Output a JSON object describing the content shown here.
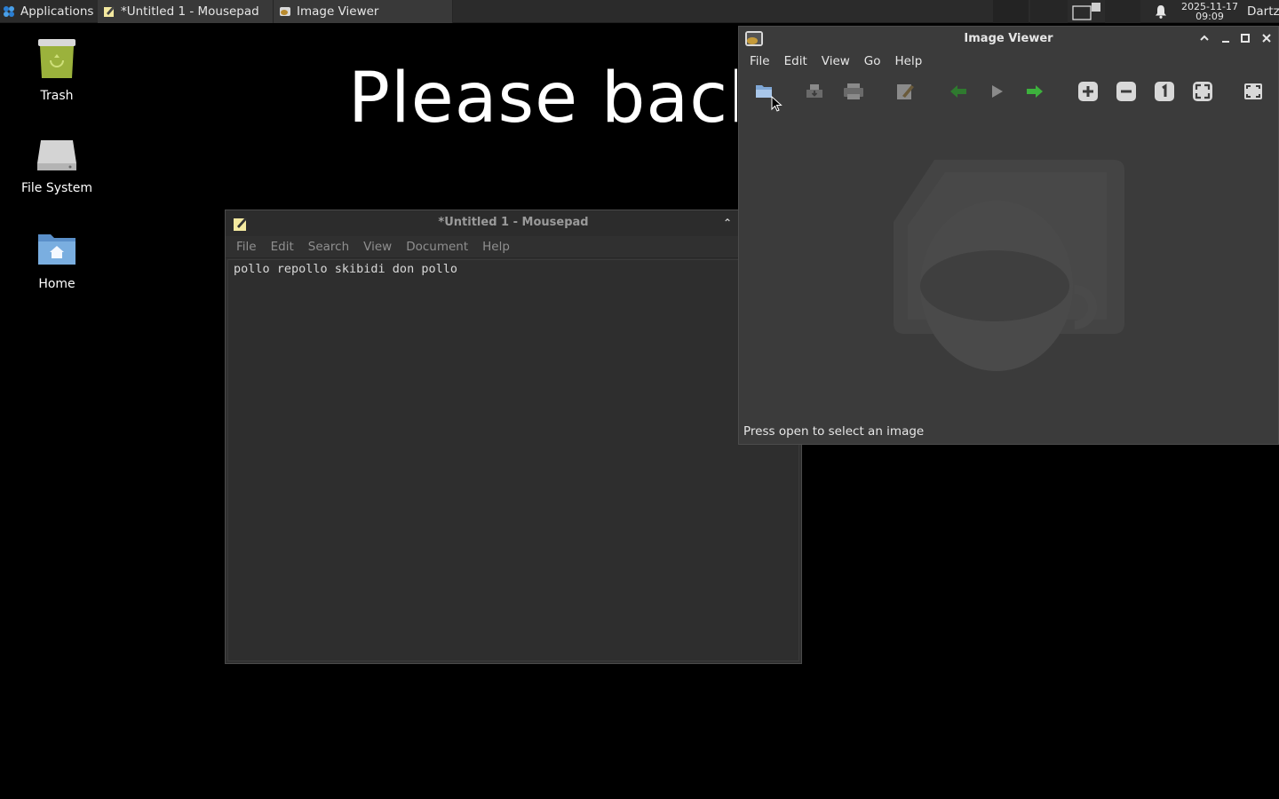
{
  "taskbar": {
    "applications_label": "Applications",
    "tasks": [
      {
        "label": "*Untitled 1 - Mousepad",
        "icon": "mousepad-icon"
      },
      {
        "label": "Image Viewer",
        "icon": "image-viewer-icon"
      }
    ],
    "clock_date": "2025-11-17",
    "clock_time": "09:09",
    "user": "Dartz"
  },
  "desktop": {
    "icons": [
      {
        "label": "Trash",
        "icon": "trash-icon"
      },
      {
        "label": "File System",
        "icon": "drive-icon"
      },
      {
        "label": "Home",
        "icon": "home-folder-icon"
      }
    ],
    "wallpaper_text": "Please back I"
  },
  "mousepad": {
    "title": "*Untitled 1 - Mousepad",
    "menu": [
      "File",
      "Edit",
      "Search",
      "View",
      "Document",
      "Help"
    ],
    "content": "pollo repollo skibidi don pollo"
  },
  "image_viewer": {
    "title": "Image Viewer",
    "menu": [
      "File",
      "Edit",
      "View",
      "Go",
      "Help"
    ],
    "toolbar": [
      "open-icon",
      "save-icon",
      "print-icon",
      "edit-icon",
      "back-icon",
      "play-icon",
      "forward-icon",
      "zoom-in-icon",
      "zoom-out-icon",
      "zoom-100-icon",
      "zoom-fit-icon",
      "fullscreen-icon"
    ],
    "status": "Press open to select an image"
  },
  "colors": {
    "taskbar_bg": "#2b2b2b",
    "window_bg": "#3b3b3b",
    "accent_green": "#3db13d"
  }
}
